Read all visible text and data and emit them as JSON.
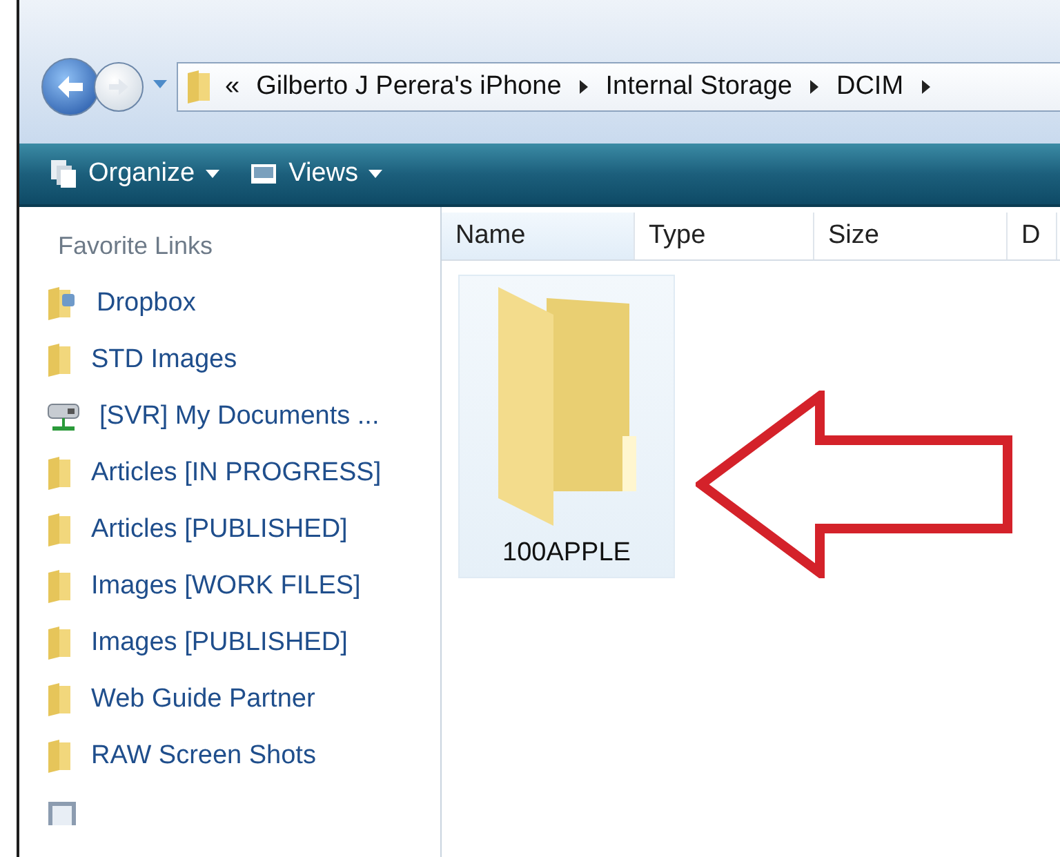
{
  "address_bar": {
    "overflow": "«",
    "crumbs": [
      "Gilberto J Perera's iPhone",
      "Internal Storage",
      "DCIM"
    ]
  },
  "toolbar": {
    "buttons": [
      "Organize",
      "Views"
    ]
  },
  "sidebar": {
    "title": "Favorite Links",
    "items": [
      {
        "label": "Dropbox",
        "kind": "dropbox"
      },
      {
        "label": "STD Images",
        "kind": "folder"
      },
      {
        "label": "[SVR] My Documents ...",
        "kind": "network"
      },
      {
        "label": "Articles [IN PROGRESS]",
        "kind": "folder"
      },
      {
        "label": "Articles [PUBLISHED]",
        "kind": "folder"
      },
      {
        "label": "Images [WORK FILES]",
        "kind": "folder"
      },
      {
        "label": "Images [PUBLISHED]",
        "kind": "folder"
      },
      {
        "label": "Web Guide Partner",
        "kind": "folder"
      },
      {
        "label": "RAW Screen Shots",
        "kind": "folder"
      },
      {
        "kind": "documents"
      }
    ]
  },
  "columns": [
    "Name",
    "Type",
    "Size",
    "D"
  ],
  "items": [
    {
      "name": "100APPLE",
      "selected": true
    }
  ]
}
